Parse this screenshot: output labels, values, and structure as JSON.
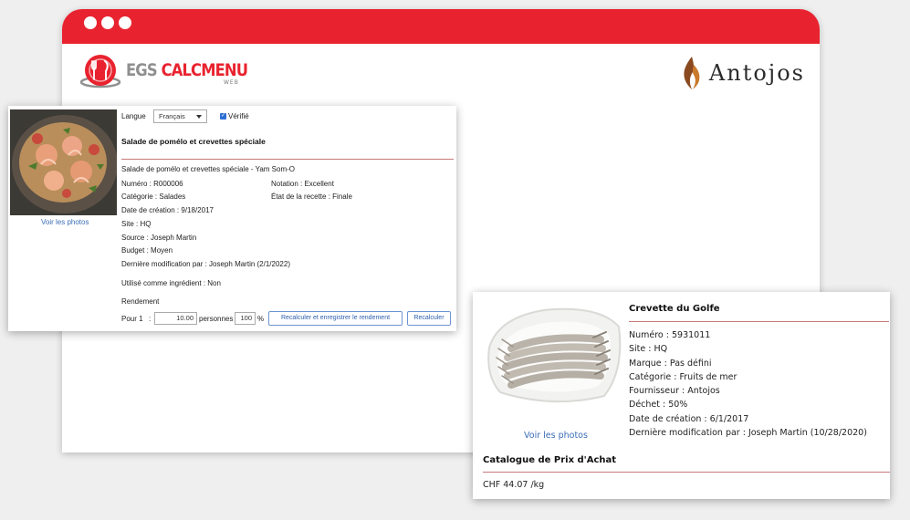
{
  "brand": {
    "name_part1": "EGS ",
    "name_part2": "CALCMENU",
    "sub": "WEB"
  },
  "partner": {
    "name": "Antojos"
  },
  "recipe": {
    "language_label": "Langue",
    "language_value": "Français",
    "verified_label": "Vérifié",
    "title": "Salade de pomélo et crevettes spéciale",
    "subtitle": "Salade de pomélo et crevettes spéciale - Yam Som-O",
    "numero": "Numéro : R000006",
    "notation": "Notation : Excellent",
    "categorie": "Catégorie : Salades",
    "etat": "État de la recette : Finale",
    "date": "Date de création : 9/18/2017",
    "site": "Site : HQ",
    "source": "Source :  Joseph Martin",
    "budget": "Budget : Moyen",
    "modif": "Dernière modification par : Joseph Martin  (2/1/2022)",
    "ingredient": "Utilisé comme ingrédient : Non",
    "rendement_label": "Rendement",
    "pour_label": "Pour 1",
    "colon": ":",
    "portions_value": "10.00",
    "personnes_label": "personnes",
    "percent_value": "100",
    "percent_sign": "%",
    "btn_recalc_save": "Recalculer et enregistrer le rendement",
    "btn_recalc": "Recalculer",
    "photos_link": "Voir les photos"
  },
  "product": {
    "title": "Crevette du Golfe",
    "numero": "Numéro : 5931011",
    "site": "Site : HQ",
    "marque": "Marque : Pas défini",
    "categorie": "Catégorie : Fruits de mer",
    "fournisseur": "Fournisseur : Antojos",
    "dechet": "Déchet : 50%",
    "date": "Date de création : 6/1/2017",
    "modif": "Dernière modification par : Joseph Martin (10/28/2020)",
    "photos_link": "Voir les photos",
    "catalogue_title": "Catalogue de Prix d'Achat",
    "price": "CHF 44.07 /kg"
  },
  "colors": {
    "accent_red": "#e8232f",
    "link_blue": "#3a6db5",
    "divider": "#c77a7a"
  },
  "icons": [
    "window-dot-icon",
    "calcmenu-logo-icon",
    "flame-logo-icon",
    "checkbox-checked-icon",
    "dropdown-caret-icon"
  ]
}
